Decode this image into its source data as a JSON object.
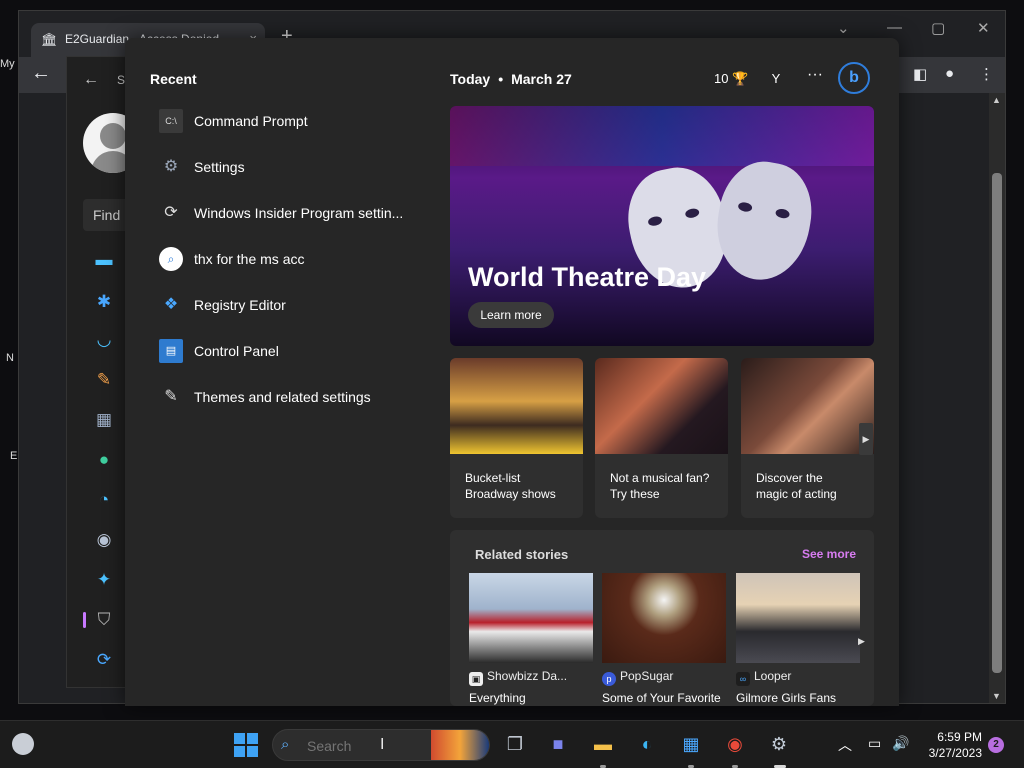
{
  "browser": {
    "tab_title": "E2Guardian - Access Denied",
    "new_tab": "+",
    "tab_close": "×",
    "back": "←"
  },
  "desktop_edge": [
    "My",
    "N",
    "E"
  ],
  "settings": {
    "title": "S",
    "find_placeholder": "Find"
  },
  "start": {
    "recent_title": "Recent",
    "recent": [
      {
        "icon": "command-prompt-icon",
        "label": "Command Prompt"
      },
      {
        "icon": "settings-gear-icon",
        "label": "Settings"
      },
      {
        "icon": "sync-icon",
        "label": "Windows Insider Program settin..."
      },
      {
        "icon": "search-icon",
        "label": "thx for the ms acc"
      },
      {
        "icon": "registry-icon",
        "label": "Registry Editor"
      },
      {
        "icon": "control-panel-icon",
        "label": "Control Panel"
      },
      {
        "icon": "brush-icon",
        "label": "Themes and related settings"
      }
    ]
  },
  "feed": {
    "today": "Today",
    "dot": "•",
    "date": "March 27",
    "points": "10",
    "avatar": "Y",
    "more": "···",
    "bing": "b",
    "hero": {
      "title": "World Theatre Day",
      "button": "Learn more"
    },
    "cards": [
      {
        "line1": "Bucket-list",
        "line2": "Broadway shows"
      },
      {
        "line1": "Not a musical fan?",
        "line2": "Try these"
      },
      {
        "line1": "Discover the",
        "line2": "magic of acting"
      }
    ],
    "related_title": "Related stories",
    "see_more": "See more",
    "stories": [
      {
        "source": "Showbizz Da...",
        "headline": "Everything"
      },
      {
        "source": "PopSugar",
        "headline": "Some of Your Favorite"
      },
      {
        "source": "Looper",
        "headline": "Gilmore Girls Fans"
      }
    ]
  },
  "taskbar": {
    "search_placeholder": "Search",
    "time": "6:59 PM",
    "date": "3/27/2023",
    "notifications": "2"
  },
  "colors": {
    "accent": "#3ea2f4",
    "see_more": "#d77cf0",
    "bing": "#2f7ddb"
  }
}
